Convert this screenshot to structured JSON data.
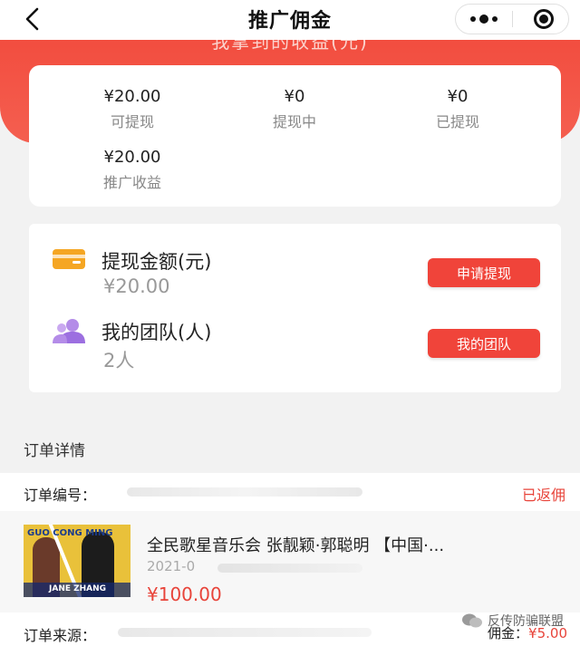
{
  "nav": {
    "title": "推广佣金"
  },
  "banner": {
    "text": "我拿到的收益(元)"
  },
  "stats": [
    {
      "amount": "¥20.00",
      "label": "可提现"
    },
    {
      "amount": "¥0",
      "label": "提现中"
    },
    {
      "amount": "¥0",
      "label": "已提现"
    },
    {
      "amount": "¥20.00",
      "label": "推广收益"
    }
  ],
  "withdraw": {
    "title": "提现金额(元)",
    "value": "¥20.00",
    "button": "申请提现"
  },
  "team": {
    "title": "我的团队(人)",
    "value": "2人",
    "button": "我的团队"
  },
  "orders": {
    "section_title": "订单详情",
    "number_label": "订单编号：",
    "status": "已返佣",
    "product_title": "全民歌星音乐会 张靓颖·郭聪明 【中国·...",
    "date": "2021-0",
    "price": "¥100.00",
    "source_label": "订单来源：",
    "commission_label": "佣金：",
    "commission_value": "¥5.00",
    "thumb_text_top": "GUO CONG MING",
    "thumb_text_bottom": "JANE ZHANG"
  },
  "watermark": "反传防骗联盟",
  "colors": {
    "accent": "#f0443a",
    "banner": "#f24b3d",
    "page_bg": "#f2f2f2"
  }
}
